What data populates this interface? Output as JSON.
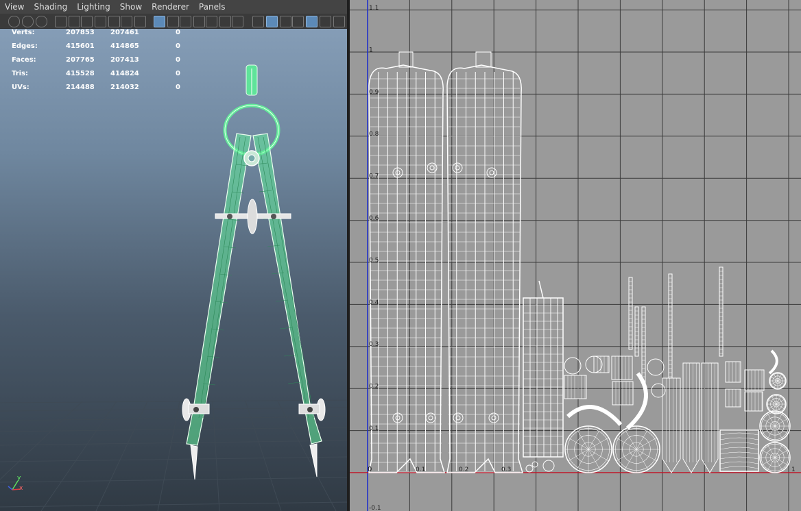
{
  "menu": [
    "View",
    "Shading",
    "Lighting",
    "Show",
    "Renderer",
    "Panels"
  ],
  "hud": [
    {
      "label": "Verts:",
      "total": "207853",
      "selected": "207461",
      "extra": "0"
    },
    {
      "label": "Edges:",
      "total": "415601",
      "selected": "414865",
      "extra": "0"
    },
    {
      "label": "Faces:",
      "total": "207765",
      "selected": "207413",
      "extra": "0"
    },
    {
      "label": "Tris:",
      "total": "415528",
      "selected": "414824",
      "extra": "0"
    },
    {
      "label": "UVs:",
      "total": "214488",
      "selected": "214032",
      "extra": "0"
    }
  ],
  "toolbar_icons": [
    "select-camera-icon",
    "lock-icon",
    "bookmark-icon",
    "camera-icon",
    "camera-attributes-icon",
    "image-plane-icon",
    "bookmark-flag-icon",
    "grease-pencil-icon",
    "move-manipulator-icon",
    "paint-brush-icon",
    "grid-icon",
    "film-gate-icon",
    "resolution-gate-icon",
    "gate-mask-icon",
    "field-chart-icon",
    "safe-action-icon",
    "safe-title-icon",
    "wireframe-icon",
    "smooth-shade-icon",
    "wireframe-on-shaded-icon",
    "default-material-icon",
    "xray-icon",
    "lights-icon",
    "shadows-icon"
  ],
  "uv_editor": {
    "u_labels": [
      "0",
      "0.1",
      "0.2",
      "0.3",
      "1"
    ],
    "v_labels": [
      "1.1",
      "1",
      "0.9",
      "0.8",
      "0.7",
      "0.6",
      "0.5",
      "0.4",
      "0.3",
      "0.2",
      "0.1",
      "-0.1"
    ]
  },
  "axis_gizmo": {
    "y": "y",
    "x": "x"
  },
  "colors": {
    "wire_selected": "#63ec9a",
    "uv_wire": "#ffffff",
    "uv_bg": "#9a9a9a",
    "u_axis": "#c0182a",
    "v_axis": "#1a2bcc"
  }
}
